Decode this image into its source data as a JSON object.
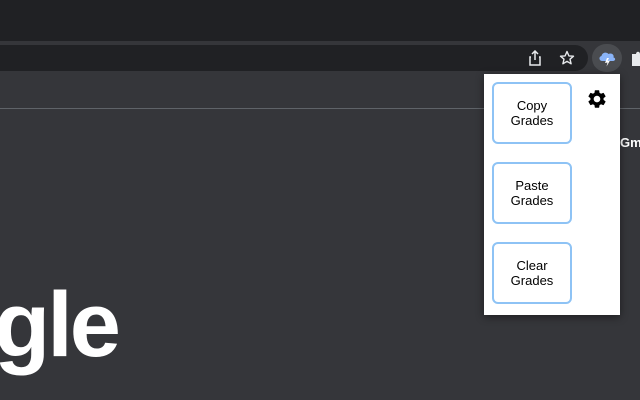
{
  "browser": {
    "toolbar_icons": [
      "share-icon",
      "bookmark-star-icon",
      "cloud-lightning-extension-icon",
      "puzzle-extensions-icon"
    ]
  },
  "page": {
    "logo_fragment": "gle",
    "side_link": "Gmail"
  },
  "popup": {
    "buttons": [
      {
        "label": "Copy\nGrades"
      },
      {
        "label": "Paste\nGrades"
      },
      {
        "label": "Clear\nGrades"
      }
    ],
    "settings_icon": "gear-icon",
    "accent_color": "#8ec3f5"
  }
}
